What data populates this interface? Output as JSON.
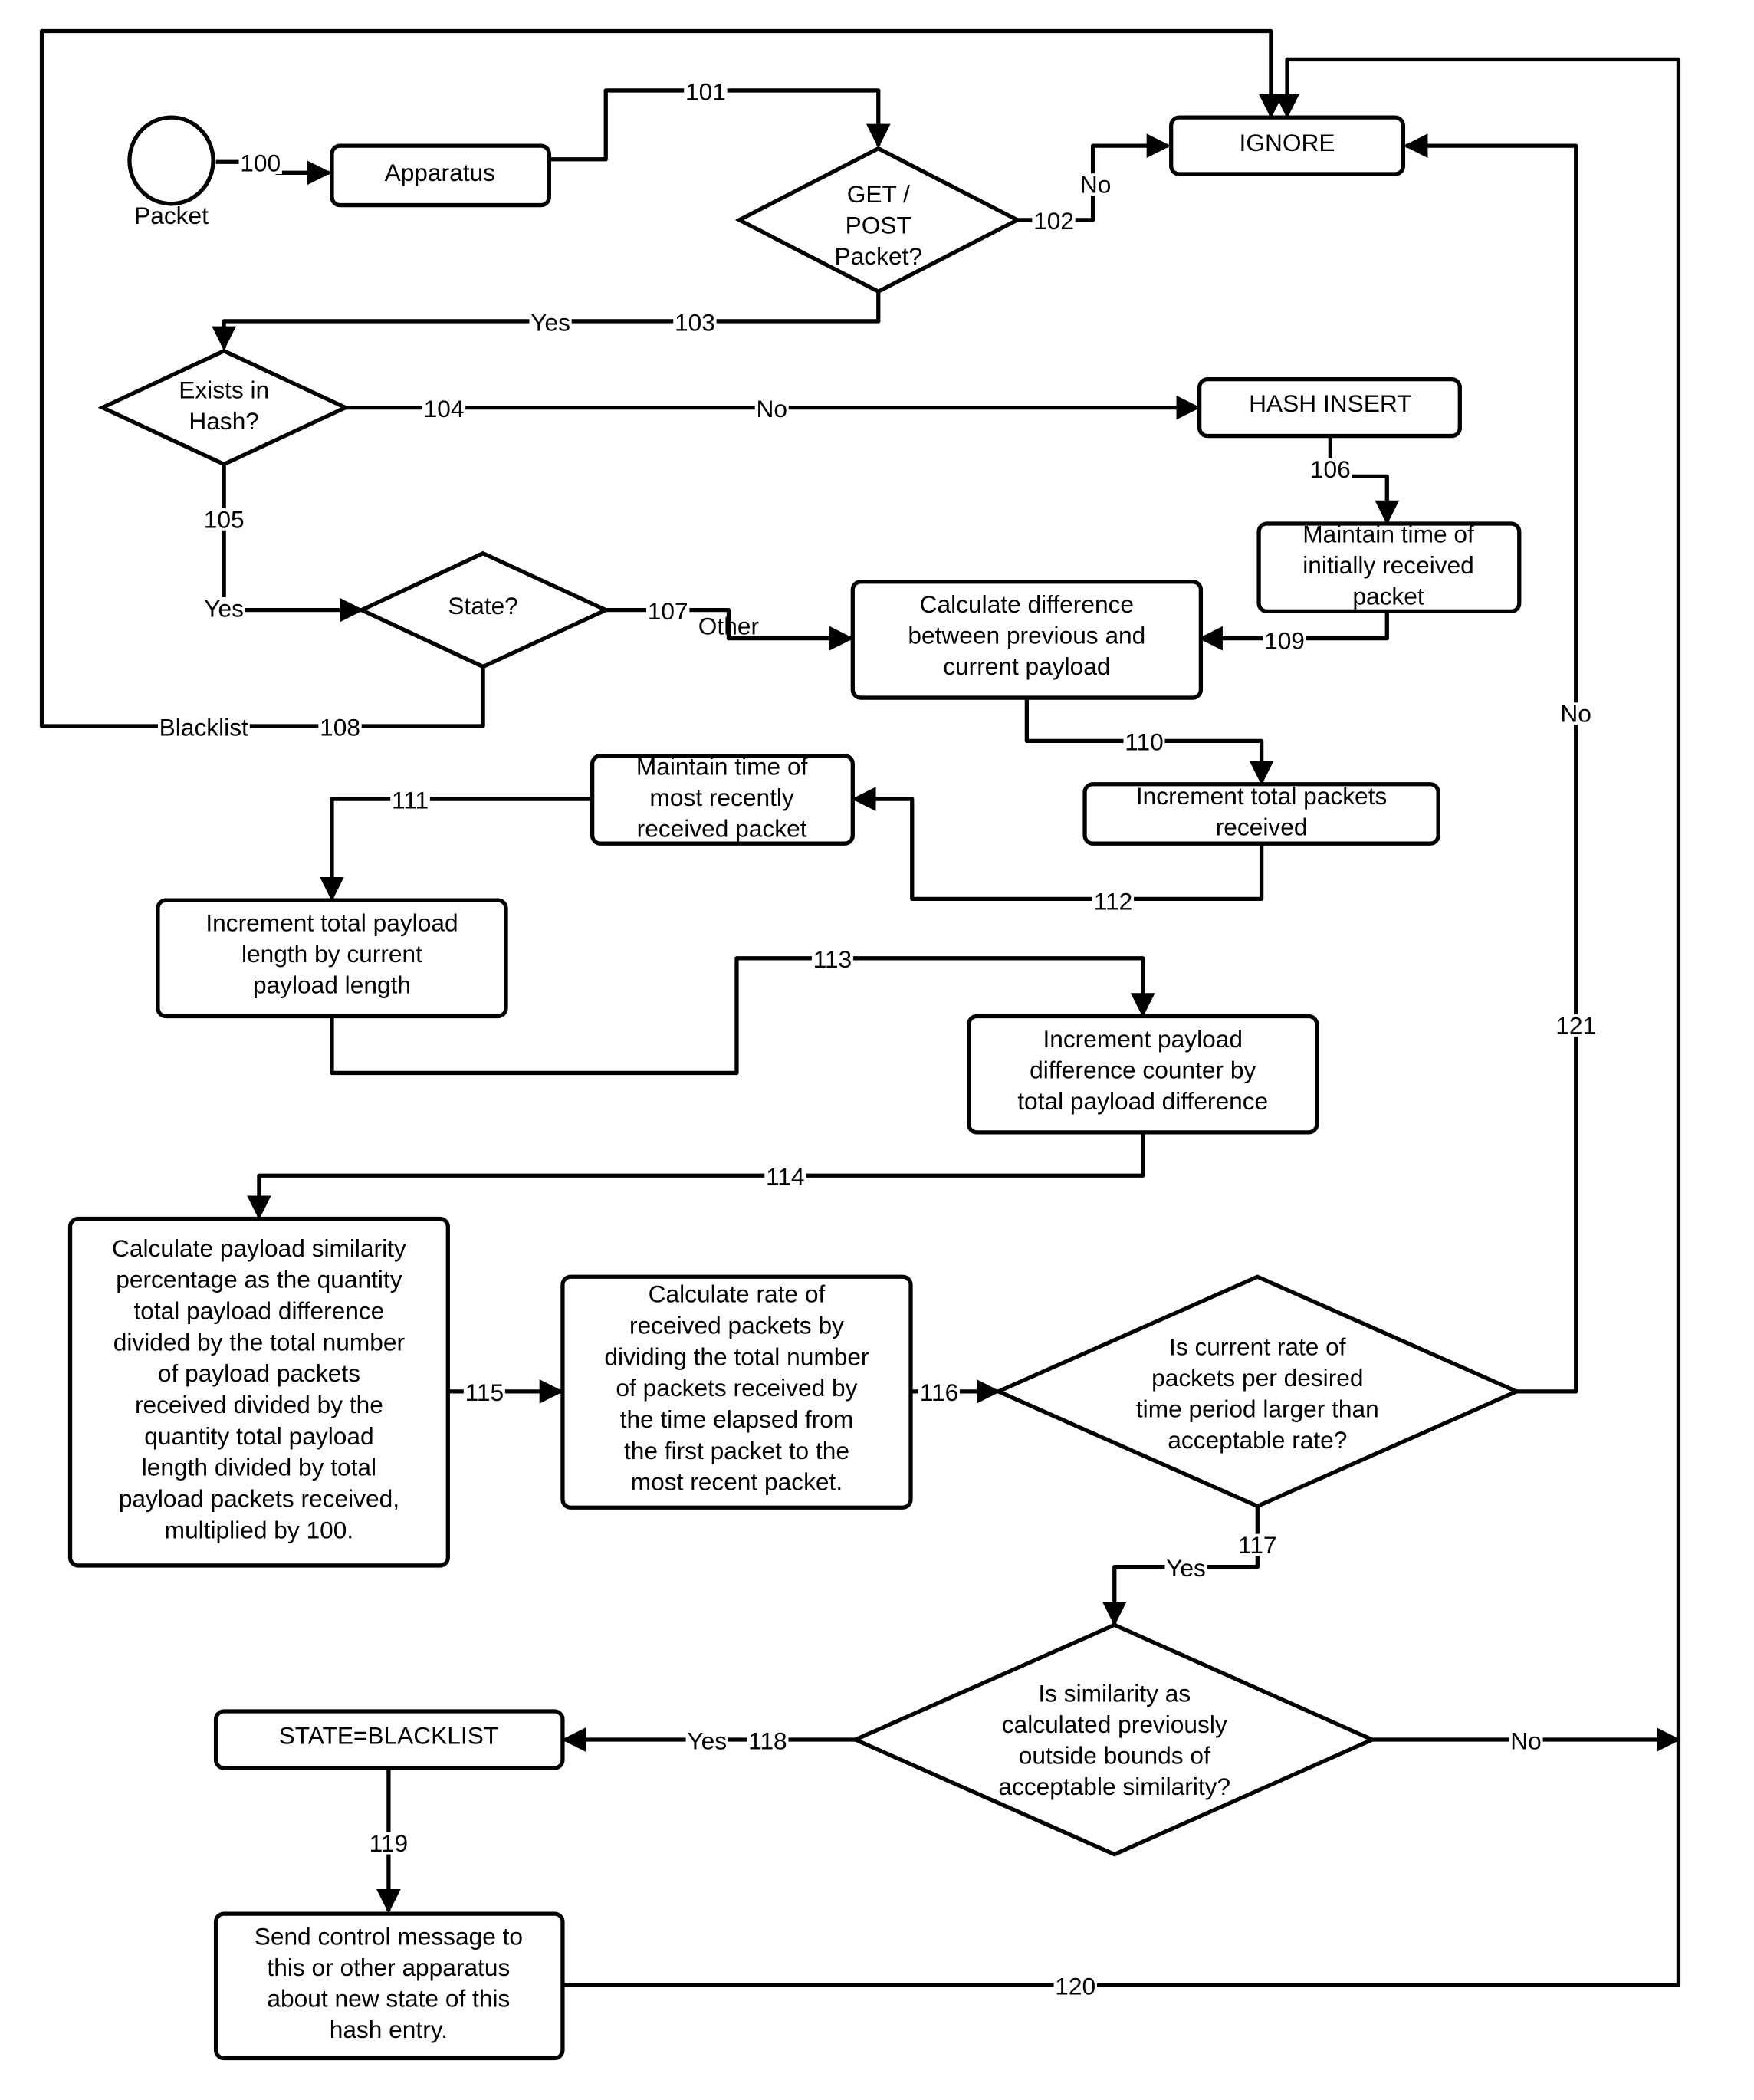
{
  "diagram": {
    "type": "flowchart",
    "line_color": "#000000",
    "background": "#ffffff",
    "nodes": {
      "packet": {
        "shape": "circle",
        "label": "Packet"
      },
      "apparatus": {
        "shape": "rounded-rect",
        "lines": [
          "Apparatus"
        ]
      },
      "get_post": {
        "shape": "diamond",
        "lines": [
          "GET /",
          "POST",
          "Packet?"
        ]
      },
      "ignore": {
        "shape": "rounded-rect",
        "lines": [
          "IGNORE"
        ]
      },
      "exists_hash": {
        "shape": "diamond",
        "lines": [
          "Exists in",
          "Hash?"
        ]
      },
      "hash_insert": {
        "shape": "rounded-rect",
        "lines": [
          "HASH INSERT"
        ]
      },
      "maintain_initial": {
        "shape": "rounded-rect",
        "lines": [
          "Maintain time of",
          "initially received",
          "packet"
        ]
      },
      "state": {
        "shape": "diamond",
        "lines": [
          "State?"
        ]
      },
      "calc_difference": {
        "shape": "rounded-rect",
        "lines": [
          "Calculate difference",
          "between previous and",
          "current payload"
        ]
      },
      "increment_packets": {
        "shape": "rounded-rect",
        "lines": [
          "Increment total packets",
          "received"
        ]
      },
      "maintain_recent": {
        "shape": "rounded-rect",
        "lines": [
          "Maintain time of",
          "most recently",
          "received packet"
        ]
      },
      "increment_length": {
        "shape": "rounded-rect",
        "lines": [
          "Increment total payload",
          "length by current",
          "payload length"
        ]
      },
      "increment_diff": {
        "shape": "rounded-rect",
        "lines": [
          "Increment payload",
          "difference counter by",
          "total payload difference"
        ]
      },
      "calc_similarity": {
        "shape": "rounded-rect",
        "lines": [
          "Calculate payload similarity",
          "percentage as the quantity",
          "total payload difference",
          "divided by the total number",
          "of payload packets",
          "received divided by the",
          "quantity total payload",
          "length divided by total",
          "payload packets received,",
          "multiplied by 100."
        ]
      },
      "calc_rate": {
        "shape": "rounded-rect",
        "lines": [
          "Calculate rate of",
          "received packets by",
          "dividing the total number",
          "of packets received by",
          "the time elapsed from",
          "the first packet to the",
          "most recent packet."
        ]
      },
      "rate_check": {
        "shape": "diamond",
        "lines": [
          "Is current rate of",
          "packets per desired",
          "time period larger than",
          "acceptable rate?"
        ]
      },
      "similarity_check": {
        "shape": "diamond",
        "lines": [
          "Is similarity as",
          "calculated previously",
          "outside bounds of",
          "acceptable similarity?"
        ]
      },
      "state_blacklist": {
        "shape": "rounded-rect",
        "lines": [
          "STATE=BLACKLIST"
        ]
      },
      "send_control": {
        "shape": "rounded-rect",
        "lines": [
          "Send control message to",
          "this or other apparatus",
          "about new state of this",
          "hash entry."
        ]
      }
    },
    "edges": {
      "e100": {
        "from": "packet",
        "to": "apparatus",
        "id_label": "100"
      },
      "e101": {
        "from": "apparatus",
        "to": "get_post",
        "id_label": "101"
      },
      "e102": {
        "from": "get_post",
        "to": "ignore",
        "id_label": "102",
        "condition": "No"
      },
      "e103": {
        "from": "get_post",
        "to": "exists_hash",
        "id_label": "103",
        "condition": "Yes"
      },
      "e104": {
        "from": "exists_hash",
        "to": "hash_insert",
        "id_label": "104",
        "condition": "No"
      },
      "e105": {
        "from": "exists_hash",
        "to": "state",
        "id_label": "105",
        "condition": "Yes"
      },
      "e106": {
        "from": "hash_insert",
        "to": "maintain_initial",
        "id_label": "106"
      },
      "e107": {
        "from": "state",
        "to": "calc_difference",
        "id_label": "107",
        "condition": "Other"
      },
      "e108": {
        "from": "state",
        "to": "ignore",
        "id_label": "108",
        "condition": "Blacklist"
      },
      "e109": {
        "from": "maintain_initial",
        "to": "calc_difference",
        "id_label": "109"
      },
      "e110": {
        "from": "calc_difference",
        "to": "increment_packets",
        "id_label": "110"
      },
      "e111": {
        "from": "maintain_recent",
        "to": "increment_length",
        "id_label": "111"
      },
      "e112": {
        "from": "increment_packets",
        "to": "maintain_recent",
        "id_label": "112"
      },
      "e113": {
        "from": "increment_length",
        "to": "increment_diff",
        "id_label": "113"
      },
      "e114": {
        "from": "increment_diff",
        "to": "calc_similarity",
        "id_label": "114"
      },
      "e115": {
        "from": "calc_similarity",
        "to": "calc_rate",
        "id_label": "115"
      },
      "e116": {
        "from": "calc_rate",
        "to": "rate_check",
        "id_label": "116"
      },
      "e117": {
        "from": "rate_check",
        "to": "similarity_check",
        "id_label": "117",
        "condition": "Yes"
      },
      "e118": {
        "from": "similarity_check",
        "to": "state_blacklist",
        "id_label": "118",
        "condition": "Yes"
      },
      "e119": {
        "from": "state_blacklist",
        "to": "send_control",
        "id_label": "119"
      },
      "e120": {
        "from": "send_control",
        "to": "ignore",
        "id_label": "120"
      },
      "e121": {
        "from": "rate_check",
        "to": "ignore",
        "id_label": "121",
        "condition": "No"
      },
      "e_sim_no": {
        "from": "similarity_check",
        "to": "ignore",
        "condition": "No"
      }
    }
  }
}
